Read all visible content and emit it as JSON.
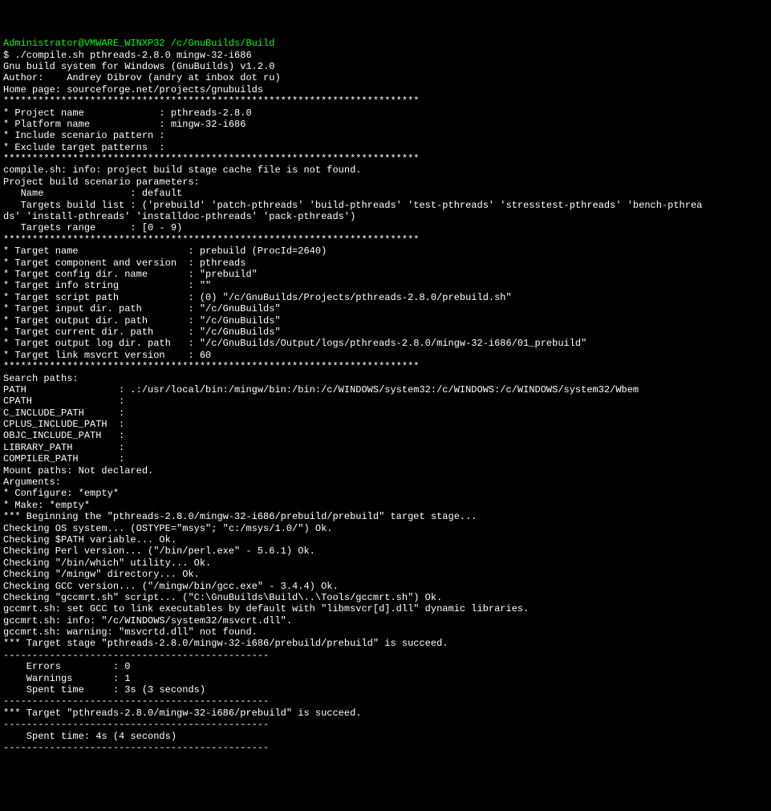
{
  "title": "Administrator@VMWARE_WINXP32 /c/GnuBuilds/Build",
  "lines": [
    "$ ./compile.sh pthreads-2.8.0 mingw-32-i686",
    "Gnu build system for Windows (GnuBuilds) v1.2.0",
    "Author:    Andrey Dibrov (andry at inbox dot ru)",
    "Home page: sourceforge.net/projects/gnubuilds",
    "",
    "************************************************************************",
    "* Project name             : pthreads-2.8.0",
    "* Platform name            : mingw-32-i686",
    "* Include scenario pattern :",
    "* Exclude target patterns  :",
    "************************************************************************",
    "",
    "compile.sh: info: project build stage cache file is not found.",
    "",
    "Project build scenario parameters:",
    "   Name               : default",
    "   Targets build list : ('prebuild' 'patch-pthreads' 'build-pthreads' 'test-pthreads' 'stresstest-pthreads' 'bench-pthrea",
    "ds' 'install-pthreads' 'installdoc-pthreads' 'pack-pthreads')",
    "   Targets range      : [0 - 9)",
    "",
    "************************************************************************",
    "* Target name                   : prebuild (ProcId=2640)",
    "* Target component and version  : pthreads",
    "* Target config dir. name       : \"prebuild\"",
    "* Target info string            : \"\"",
    "* Target script path            : (0) \"/c/GnuBuilds/Projects/pthreads-2.8.0/prebuild.sh\"",
    "* Target input dir. path        : \"/c/GnuBuilds\"",
    "* Target output dir. path       : \"/c/GnuBuilds\"",
    "* Target current dir. path      : \"/c/GnuBuilds\"",
    "* Target output log dir. path   : \"/c/GnuBuilds/Output/logs/pthreads-2.8.0/mingw-32-i686/01_prebuild\"",
    "* Target link msvcrt version    : 60",
    "************************************************************************",
    "",
    "Search paths:",
    "PATH                : .:/usr/local/bin:/mingw/bin:/bin:/c/WINDOWS/system32:/c/WINDOWS:/c/WINDOWS/system32/Wbem",
    "CPATH               :",
    "C_INCLUDE_PATH      :",
    "CPLUS_INCLUDE_PATH  :",
    "OBJC_INCLUDE_PATH   :",
    "LIBRARY_PATH        :",
    "COMPILER_PATH       :",
    "",
    "Mount paths: Not declared.",
    "",
    "Arguments:",
    "* Configure: *empty*",
    "* Make: *empty*",
    "",
    "*** Beginning the \"pthreads-2.8.0/mingw-32-i686/prebuild/prebuild\" target stage...",
    "Checking OS system... (OSTYPE=\"msys\"; \"c:/msys/1.0/\") Ok.",
    "Checking $PATH variable... Ok.",
    "Checking Perl version... (\"/bin/perl.exe\" - 5.6.1) Ok.",
    "Checking \"/bin/which\" utility... Ok.",
    "Checking \"/mingw\" directory... Ok.",
    "Checking GCC version... (\"/mingw/bin/gcc.exe\" - 3.4.4) Ok.",
    "Checking \"gccmrt.sh\" script... (\"C:\\GnuBuilds\\Build\\..\\Tools/gccmrt.sh\") Ok.",
    "gccmrt.sh: set GCC to link executables by default with \"libmsvcr[d].dll\" dynamic libraries.",
    "gccmrt.sh: info: \"/c/WINDOWS/system32/msvcrt.dll\".",
    "gccmrt.sh: warning: \"msvcrtd.dll\" not found.",
    "",
    "*** Target stage \"pthreads-2.8.0/mingw-32-i686/prebuild/prebuild\" is succeed.",
    "----------------------------------------------",
    "    Errors         : 0",
    "    Warnings       : 1",
    "",
    "    Spent time     : 3s (3 seconds)",
    "----------------------------------------------",
    "",
    "*** Target \"pthreads-2.8.0/mingw-32-i686/prebuild\" is succeed.",
    "----------------------------------------------",
    "    Spent time: 4s (4 seconds)",
    "----------------------------------------------"
  ]
}
